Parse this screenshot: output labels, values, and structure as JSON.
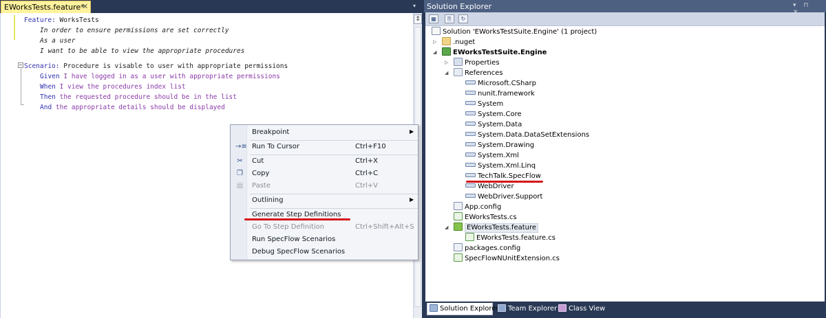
{
  "editor": {
    "tab_title": "EWorksTests.feature*",
    "close_glyph": "✕",
    "dropdown_glyph": "▾",
    "split_glyph": "⇕",
    "collapse_glyph": "−",
    "lines": [
      {
        "kw": "Feature:",
        "rest": " WorksTests"
      },
      {
        "italic": "In order to ensure permissions are set correctly"
      },
      {
        "italic": "As a user"
      },
      {
        "italic": "I want to be able to view the appropriate procedures"
      },
      {
        "kw": "Scenario:",
        "rest": " Procedure is visable to user with appropriate permissions"
      },
      {
        "kw": "Given",
        "rest": " I have logged in as a user with appropriate permissions"
      },
      {
        "kw": "When",
        "rest": " I view the procedures index list"
      },
      {
        "kw": "Then",
        "rest": " the requested procedure should be in the list"
      },
      {
        "kw": "And",
        "rest": " the appropriate details should be displayed"
      }
    ]
  },
  "context_menu": {
    "items": [
      {
        "label": "Breakpoint",
        "shortcut": "",
        "submenu": true,
        "disabled": false,
        "icon": ""
      },
      {
        "label": "Run To Cursor",
        "shortcut": "Ctrl+F10",
        "submenu": false,
        "disabled": false,
        "icon": "run-to-cursor-icon"
      },
      {
        "label": "Cut",
        "shortcut": "Ctrl+X",
        "submenu": false,
        "disabled": false,
        "icon": "cut-icon"
      },
      {
        "label": "Copy",
        "shortcut": "Ctrl+C",
        "submenu": false,
        "disabled": false,
        "icon": "copy-icon"
      },
      {
        "label": "Paste",
        "shortcut": "Ctrl+V",
        "submenu": false,
        "disabled": true,
        "icon": "paste-icon"
      },
      {
        "label": "Outlining",
        "shortcut": "",
        "submenu": true,
        "disabled": false,
        "icon": ""
      },
      {
        "label": "Generate Step Definitions",
        "shortcut": "",
        "submenu": false,
        "disabled": false,
        "icon": ""
      },
      {
        "label": "Go To Step Definition",
        "shortcut": "Ctrl+Shift+Alt+S",
        "submenu": false,
        "disabled": true,
        "icon": ""
      },
      {
        "label": "Run SpecFlow Scenarios",
        "shortcut": "",
        "submenu": false,
        "disabled": false,
        "icon": ""
      },
      {
        "label": "Debug SpecFlow Scenarios",
        "shortcut": "",
        "submenu": false,
        "disabled": false,
        "icon": ""
      }
    ],
    "run_icon_glyph": "→≡",
    "cut_icon_glyph": "✂",
    "copy_icon_glyph": "❐",
    "paste_icon_glyph": "▤",
    "submenu_glyph": "▶",
    "highlight_color": "#d5131b"
  },
  "solution_explorer": {
    "title": "Solution Explorer",
    "title_buttons": "▾ ⊓ ✕",
    "toolbar": [
      "properties-icon",
      "show-all-files-icon",
      "refresh-icon"
    ],
    "toolbar_glyphs": [
      "▦",
      "⎘",
      "↻"
    ],
    "tree": [
      {
        "label": "Solution 'EWorksTestSuite.Engine' (1 project)",
        "icon": "solution-icon",
        "bold": false,
        "expander": ""
      },
      {
        "label": ".nuget",
        "icon": "folder-icon",
        "bold": false,
        "expander": "▷"
      },
      {
        "label": "EWorksTestSuite.Engine",
        "icon": "csharp-project-icon",
        "bold": true,
        "expander": "◢"
      },
      {
        "label": "Properties",
        "icon": "properties-folder-icon",
        "bold": false,
        "expander": "▷"
      },
      {
        "label": "References",
        "icon": "references-folder-icon",
        "bold": false,
        "expander": "◢"
      },
      {
        "label": "Microsoft.CSharp",
        "icon": "reference-icon",
        "bold": false,
        "expander": ""
      },
      {
        "label": "nunit.framework",
        "icon": "reference-icon",
        "bold": false,
        "expander": ""
      },
      {
        "label": "System",
        "icon": "reference-icon",
        "bold": false,
        "expander": ""
      },
      {
        "label": "System.Core",
        "icon": "reference-icon",
        "bold": false,
        "expander": ""
      },
      {
        "label": "System.Data",
        "icon": "reference-icon",
        "bold": false,
        "expander": ""
      },
      {
        "label": "System.Data.DataSetExtensions",
        "icon": "reference-icon",
        "bold": false,
        "expander": ""
      },
      {
        "label": "System.Drawing",
        "icon": "reference-icon",
        "bold": false,
        "expander": ""
      },
      {
        "label": "System.Xml",
        "icon": "reference-icon",
        "bold": false,
        "expander": ""
      },
      {
        "label": "System.Xml.Linq",
        "icon": "reference-icon",
        "bold": false,
        "expander": ""
      },
      {
        "label": "TechTalk.SpecFlow",
        "icon": "reference-icon",
        "bold": false,
        "expander": ""
      },
      {
        "label": "WebDriver",
        "icon": "reference-icon",
        "bold": false,
        "expander": ""
      },
      {
        "label": "WebDriver.Support",
        "icon": "reference-icon",
        "bold": false,
        "expander": ""
      },
      {
        "label": "App.config",
        "icon": "config-file-icon",
        "bold": false,
        "expander": ""
      },
      {
        "label": "EWorksTests.cs",
        "icon": "cs-file-icon",
        "bold": false,
        "expander": ""
      },
      {
        "label": "EWorksTests.feature",
        "icon": "feature-file-icon",
        "bold": false,
        "expander": "◢",
        "selected": true
      },
      {
        "label": "EWorksTests.feature.cs",
        "icon": "cs-file-icon",
        "bold": false,
        "expander": ""
      },
      {
        "label": "packages.config",
        "icon": "config-file-icon",
        "bold": false,
        "expander": ""
      },
      {
        "label": "SpecFlowNUnitExtension.cs",
        "icon": "cs-file-icon",
        "bold": false,
        "expander": ""
      }
    ],
    "tabs": [
      {
        "label": "Solution Explorer",
        "active": true
      },
      {
        "label": "Team Explorer",
        "active": false
      },
      {
        "label": "Class View",
        "active": false
      }
    ]
  }
}
